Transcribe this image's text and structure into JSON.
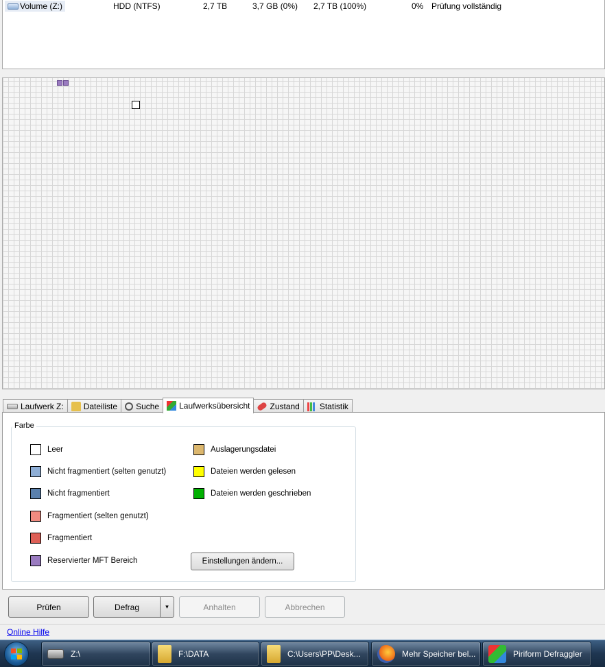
{
  "drive_list": {
    "rows": [
      {
        "name": "Volume (Z:)",
        "media": "HDD (NTFS)",
        "capacity": "2,7 TB",
        "used": "3,7 GB (0%)",
        "free": "2,7 TB (100%)",
        "fragmentation": "0%",
        "status": "Prüfung vollständig"
      }
    ]
  },
  "tabs": [
    {
      "label": "Laufwerk Z:",
      "icon": "drive-icon",
      "active": false
    },
    {
      "label": "Dateiliste",
      "icon": "folder-icon",
      "active": false
    },
    {
      "label": "Suche",
      "icon": "search-icon",
      "active": false
    },
    {
      "label": "Laufwerksübersicht",
      "icon": "drive-map-icon",
      "active": true
    },
    {
      "label": "Zustand",
      "icon": "health-icon",
      "active": false
    },
    {
      "label": "Statistik",
      "icon": "statistics-icon",
      "active": false
    }
  ],
  "legend": {
    "title": "Farbe",
    "items": [
      {
        "label": "Leer",
        "color": "#ffffff"
      },
      {
        "label": "Nicht fragmentiert (selten genutzt)",
        "color": "#8eaed6"
      },
      {
        "label": "Nicht fragmentiert",
        "color": "#5a80ad"
      },
      {
        "label": "Fragmentiert (selten genutzt)",
        "color": "#f08b80"
      },
      {
        "label": "Fragmentiert",
        "color": "#dd5f56"
      },
      {
        "label": "Reservierter MFT Bereich",
        "color": "#9a7bc0"
      },
      {
        "label": "Auslagerungsdatei",
        "color": "#dcb76e"
      },
      {
        "label": "Dateien werden gelesen",
        "color": "#ffff00"
      },
      {
        "label": "Dateien werden geschrieben",
        "color": "#00b000"
      }
    ],
    "settings_button": "Einstellungen ändern..."
  },
  "actions": {
    "analyze": "Prüfen",
    "defrag": "Defrag",
    "defrag_menu_arrow": "▾",
    "pause": "Anhalten",
    "cancel": "Abbrechen"
  },
  "help_link": "Online Hilfe",
  "taskbar": {
    "items": [
      {
        "label": "Z:\\",
        "icon": "drive-icon"
      },
      {
        "label": "F:\\DATA",
        "icon": "folder-icon"
      },
      {
        "label": "C:\\Users\\PP\\Desk...",
        "icon": "folder-icon"
      },
      {
        "label": "Mehr Speicher bel...",
        "icon": "firefox-icon"
      },
      {
        "label": "Piriform Defraggler",
        "icon": "defraggler-icon"
      }
    ]
  }
}
